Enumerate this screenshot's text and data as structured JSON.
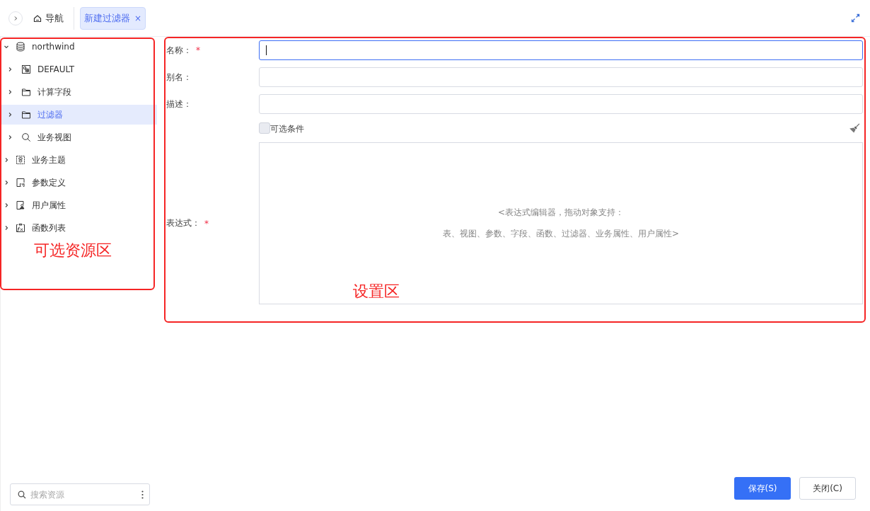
{
  "topbar": {
    "nav_label": "导航",
    "tabs": [
      {
        "label": "新建过滤器",
        "close": "×",
        "selected": true
      }
    ]
  },
  "tree": [
    {
      "label": "northwind",
      "kind": "database",
      "expanded": true,
      "selected": false,
      "children": [
        {
          "label": "DEFAULT",
          "kind": "schema",
          "expanded": false,
          "selected": false
        },
        {
          "label": "计算字段",
          "kind": "folder",
          "expanded": false,
          "selected": false
        },
        {
          "label": "过滤器",
          "kind": "folder",
          "expanded": false,
          "selected": true
        },
        {
          "label": "业务视图",
          "kind": "view",
          "expanded": false,
          "selected": false
        }
      ]
    },
    {
      "label": "业务主题",
      "kind": "topic",
      "expanded": false,
      "selected": false
    },
    {
      "label": "参数定义",
      "kind": "parameter",
      "expanded": false,
      "selected": false
    },
    {
      "label": "用户属性",
      "kind": "user",
      "expanded": false,
      "selected": false
    },
    {
      "label": "函数列表",
      "kind": "function",
      "expanded": false,
      "selected": false
    }
  ],
  "search": {
    "placeholder": "搜索资源"
  },
  "form": {
    "fields": [
      {
        "label": "名称：",
        "required_mark": "*",
        "focused": true
      },
      {
        "label": "别名：",
        "focused": false
      },
      {
        "label": "描述：",
        "focused": false
      }
    ],
    "optional": {
      "label": "可选条件",
      "checked": false
    },
    "expression": {
      "label": "表达式：",
      "required_mark": "*",
      "hint_lines": [
        "<表达式编辑器，拖动对象支持：",
        "表、视图、参数、字段、函数、过滤器、业务属性、用户属性>"
      ]
    }
  },
  "buttons": [
    {
      "label": "保存(S)",
      "kind": "primary"
    },
    {
      "label": "关闭(C)",
      "kind": "default"
    }
  ],
  "annotations": [
    {
      "label": "可选资源区",
      "kind": "resources"
    },
    {
      "label": "设置区",
      "kind": "settings"
    }
  ]
}
